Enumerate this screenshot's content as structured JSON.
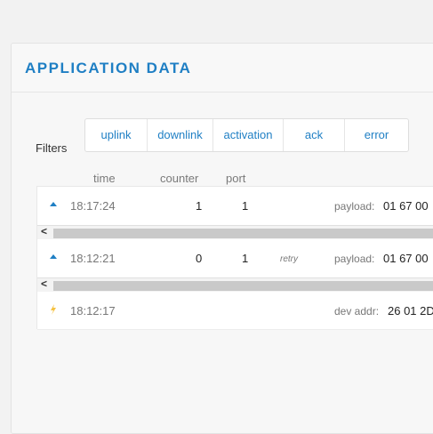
{
  "header": {
    "title": "APPLICATION DATA"
  },
  "filters": {
    "label": "Filters",
    "buttons": [
      "uplink",
      "downlink",
      "activation",
      "ack",
      "error"
    ]
  },
  "columns": {
    "time": "time",
    "counter": "counter",
    "port": "port"
  },
  "rows": [
    {
      "icon": "uplink-arrow-icon",
      "time": "18:17:24",
      "counter": "1",
      "port": "1",
      "retry": "",
      "key": "payload:",
      "value": "01 67 00"
    },
    {
      "icon": "uplink-arrow-icon",
      "time": "18:12:21",
      "counter": "0",
      "port": "1",
      "retry": "retry",
      "key": "payload:",
      "value": "01 67 00"
    },
    {
      "icon": "activation-bolt-icon",
      "time": "18:12:17",
      "counter": "",
      "port": "",
      "retry": "",
      "key": "dev addr:",
      "value": "26 01 2D"
    }
  ],
  "scroll": {
    "left_arrow": "<"
  },
  "colors": {
    "accent": "#1f7fc4",
    "bolt": "#f5c242"
  }
}
